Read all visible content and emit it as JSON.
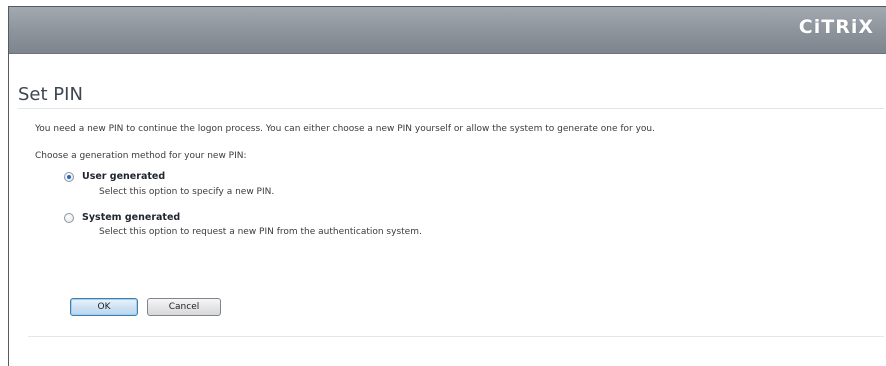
{
  "header": {
    "logo_text": "CiTRiX",
    "logo_icon": "citrix-logo"
  },
  "page": {
    "title": "Set PIN",
    "intro": "You need a new PIN to continue the logon process. You can either choose a new PIN yourself or allow the system to generate one for you.",
    "choose_label": "Choose a generation method for your new PIN:"
  },
  "options": [
    {
      "label": "User generated",
      "description": "Select this option to specify a new PIN.",
      "selected": true
    },
    {
      "label": "System generated",
      "description": "Select this option to request a new PIN from the authentication system.",
      "selected": false
    }
  ],
  "buttons": {
    "ok": "OK",
    "cancel": "Cancel"
  },
  "colors": {
    "header_bar": "#8c939b",
    "title_text": "#3d4652",
    "radio_selected": "#2d64c4",
    "ok_button": "#cfe3f5"
  }
}
